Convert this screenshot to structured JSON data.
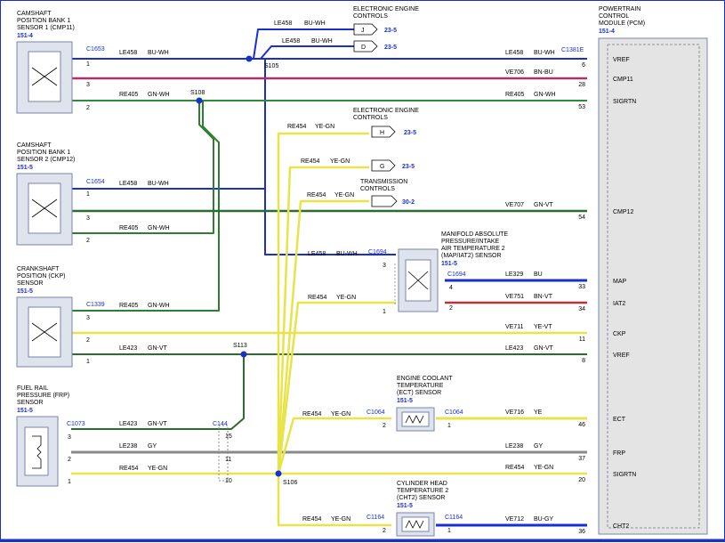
{
  "components": {
    "cmp11": {
      "lines": [
        "CAMSHAFT",
        "POSITION BANK 1",
        "SENSOR 1 (CMP11)"
      ],
      "ref": "151-4",
      "connector": "C1653",
      "pins": [
        "1",
        "3",
        "2"
      ]
    },
    "cmp12": {
      "lines": [
        "CAMSHAFT",
        "POSITION BANK 1",
        "SENSOR 2 (CMP12)"
      ],
      "ref": "151-5",
      "connector": "C1654",
      "pins": [
        "1",
        "3",
        "2"
      ]
    },
    "ckp": {
      "lines": [
        "CRANKSHAFT",
        "POSITION (CKP)",
        "SENSOR"
      ],
      "ref": "151-5",
      "connector": "C1339",
      "pins": [
        "3",
        "2",
        "1"
      ]
    },
    "frp": {
      "lines": [
        "FUEL RAIL",
        "PRESSURE (FRP)",
        "SENSOR"
      ],
      "ref": "151-5",
      "connector": "C1073",
      "pins": [
        "3",
        "2",
        "1"
      ]
    },
    "map": {
      "lines": [
        "MANIFOLD ABSOLUTE",
        "PRESSURE/INTAKE",
        "AIR TEMPERATURE 2",
        "(MAP/IAT2) SENSOR"
      ],
      "ref": "151-5",
      "connector_in": "C1694",
      "connector_out": "C1694",
      "pins": [
        "3",
        "1",
        "4",
        "2"
      ]
    },
    "ect": {
      "lines": [
        "ENGINE COOLANT",
        "TEMPERATURE",
        "(ECT) SENSOR"
      ],
      "ref": "151-5",
      "connector_in": "C1064",
      "connector_out": "C1064",
      "pins": [
        "2",
        "1"
      ]
    },
    "cht2": {
      "lines": [
        "CYLINDER HEAD",
        "TEMPERATURE 2",
        "(CHT2) SENSOR"
      ],
      "ref": "151-5",
      "connector_in": "C1164",
      "connector_out": "C1164",
      "pins": [
        "2",
        "1"
      ]
    },
    "pcm": {
      "lines": [
        "POWERTRAIN",
        "CONTROL",
        "MODULE (PCM)"
      ],
      "ref": "151-4",
      "connector": "C1381E"
    },
    "eec1": {
      "lines": [
        "ELECTRONIC ENGINE",
        "CONTROLS"
      ]
    },
    "eec2": {
      "lines": [
        "ELECTRONIC ENGINE",
        "CONTROLS"
      ]
    },
    "trans": {
      "lines": [
        "TRANSMISSION",
        "CONTROLS"
      ]
    }
  },
  "offpage": [
    {
      "letter": "J",
      "ref": "23-5",
      "circuit": "LE458",
      "color": "BU-WH"
    },
    {
      "letter": "D",
      "ref": "23-5",
      "circuit": "LE458",
      "color": "BU-WH"
    },
    {
      "letter": "H",
      "ref": "23-5",
      "circuit": "RE454",
      "color": "YE-GN"
    },
    {
      "letter": "G",
      "ref": "23-5",
      "circuit": "RE454",
      "color": "YE-GN"
    },
    {
      "letter": "",
      "ref": "30-2",
      "circuit": "RE454",
      "color": "YE-GN"
    }
  ],
  "splices": {
    "s105": "S105",
    "s108": "S108",
    "s113": "S113",
    "s106": "S106"
  },
  "inline_connector": {
    "name": "C144",
    "pins": [
      "15",
      "11",
      "10"
    ]
  },
  "pcm_pins": [
    {
      "pin": "6",
      "signal": "VREF",
      "circuit": "LE458",
      "color": "BU-WH"
    },
    {
      "pin": "28",
      "signal": "CMP11",
      "circuit": "VE706",
      "color": "BN-BU"
    },
    {
      "pin": "53",
      "signal": "SIGRTN",
      "circuit": "RE405",
      "color": "GN-WH"
    },
    {
      "pin": "54",
      "signal": "CMP12",
      "circuit": "VE707",
      "color": "GN-VT"
    },
    {
      "pin": "33",
      "signal": "MAP",
      "circuit": "LE329",
      "color": "BU"
    },
    {
      "pin": "34",
      "signal": "IAT2",
      "circuit": "VE751",
      "color": "BN-VT"
    },
    {
      "pin": "11",
      "signal": "CKP",
      "circuit": "VE711",
      "color": "YE-VT"
    },
    {
      "pin": "8",
      "signal": "VREF",
      "circuit": "LE423",
      "color": "GN-VT"
    },
    {
      "pin": "46",
      "signal": "ECT",
      "circuit": "VE716",
      "color": "YE"
    },
    {
      "pin": "37",
      "signal": "FRP",
      "circuit": "LE238",
      "color": "GY"
    },
    {
      "pin": "20",
      "signal": "SIGRTN",
      "circuit": "RE454",
      "color": "YE-GN"
    },
    {
      "pin": "36",
      "signal": "CHT2",
      "circuit": "VE712",
      "color": "BU-GY"
    }
  ],
  "wire_labels": {
    "cmp11_vref": {
      "circuit": "LE458",
      "color": "BU-WH"
    },
    "cmp11_rtn": {
      "circuit": "RE405",
      "color": "GN-WH"
    },
    "cmp12_vref": {
      "circuit": "LE458",
      "color": "BU-WH"
    },
    "cmp12_rtn": {
      "circuit": "RE405",
      "color": "GN-WH"
    },
    "ckp_rtn": {
      "circuit": "RE405",
      "color": "GN-WH"
    },
    "ckp_vref": {
      "circuit": "LE423",
      "color": "GN-VT"
    },
    "map_vref": {
      "circuit": "LE458",
      "color": "BU-WH"
    },
    "map_rtn": {
      "circuit": "RE454",
      "color": "YE-GN"
    },
    "frp_vref": {
      "circuit": "LE423",
      "color": "GN-VT"
    },
    "frp_sig": {
      "circuit": "LE238",
      "color": "GY"
    },
    "frp_rtn": {
      "circuit": "RE454",
      "color": "YE-GN"
    },
    "ect_rtn": {
      "circuit": "RE454",
      "color": "YE-GN"
    },
    "cht2_rtn": {
      "circuit": "RE454",
      "color": "YE-GN"
    }
  },
  "colors": {
    "blue_white": "#1a2fd0",
    "green_white": "#2e7d32",
    "yellow_green": "#e9e34a",
    "brown_blue": "#b0306a",
    "green_violet": "#2e6b2e",
    "grey": "#8a8a8a",
    "blue": "#1a2fd0",
    "brown_violet": "#c0303a",
    "frame": "#1a2fd0"
  }
}
